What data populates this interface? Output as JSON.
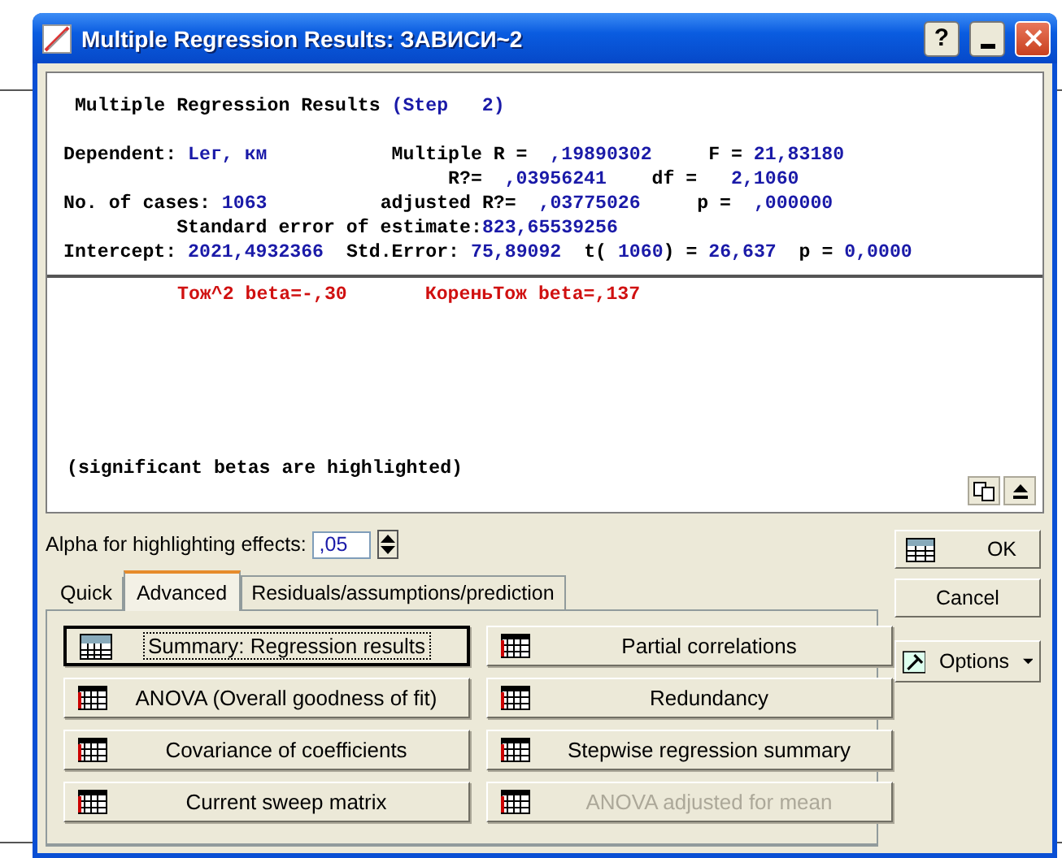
{
  "window": {
    "title": "Multiple Regression Results: ЗАВИСИ~2",
    "help_label": "?"
  },
  "report": {
    "lines": [
      [
        {
          "text": " Multiple Regression Results ",
          "kind": "label"
        },
        {
          "text": "(Step   2)",
          "kind": "value"
        }
      ],
      [
        {
          "text": "Dependent: ",
          "kind": "label"
        },
        {
          "text": "Lег, км",
          "kind": "value"
        },
        {
          "text": "           Multiple R =  ",
          "kind": "label"
        },
        {
          "text": ",19890302",
          "kind": "value"
        },
        {
          "text": "     F = ",
          "kind": "label"
        },
        {
          "text": "21,83180",
          "kind": "value"
        }
      ],
      [
        {
          "text": "                                  R?=  ",
          "kind": "label"
        },
        {
          "text": ",03956241",
          "kind": "value"
        },
        {
          "text": "    df =   ",
          "kind": "label"
        },
        {
          "text": "2,1060",
          "kind": "value"
        }
      ],
      [
        {
          "text": "No. of cases: ",
          "kind": "label"
        },
        {
          "text": "1063",
          "kind": "value"
        },
        {
          "text": "          adjusted R?=  ",
          "kind": "label"
        },
        {
          "text": ",03775026",
          "kind": "value"
        },
        {
          "text": "     p =  ",
          "kind": "label"
        },
        {
          "text": ",000000",
          "kind": "value"
        }
      ],
      [
        {
          "text": "          Standard error of estimate:",
          "kind": "label"
        },
        {
          "text": "823,65539256",
          "kind": "value"
        }
      ],
      [
        {
          "text": "Intercept: ",
          "kind": "label"
        },
        {
          "text": "2021,4932366",
          "kind": "value"
        },
        {
          "text": "  Std.Error: ",
          "kind": "label"
        },
        {
          "text": "75,89092",
          "kind": "value"
        },
        {
          "text": "  t( ",
          "kind": "label"
        },
        {
          "text": "1060",
          "kind": "value"
        },
        {
          "text": ") = ",
          "kind": "label"
        },
        {
          "text": "26,637",
          "kind": "value"
        },
        {
          "text": "  p = ",
          "kind": "label"
        },
        {
          "text": "0,0000",
          "kind": "value"
        }
      ]
    ],
    "betas": [
      {
        "text": "Тож^2 beta=-,30",
        "significant": true
      },
      {
        "text": "КореньТож beta=,137",
        "significant": true
      }
    ],
    "note": "(significant betas are highlighted)"
  },
  "alpha": {
    "label": "Alpha for highlighting effects:",
    "value": ",05"
  },
  "tabs": [
    {
      "label": "Quick",
      "selected": false
    },
    {
      "label": "Advanced",
      "selected": true
    },
    {
      "label": "Residuals/assumptions/prediction",
      "selected": false
    }
  ],
  "actions": [
    {
      "label": "Summary:  Regression results",
      "kind": "summary",
      "focused": true,
      "disabled": false
    },
    {
      "label": "Partial correlations",
      "kind": "table",
      "focused": false,
      "disabled": false
    },
    {
      "label": "ANOVA (Overall goodness of fit)",
      "kind": "table",
      "focused": false,
      "disabled": false
    },
    {
      "label": "Redundancy",
      "kind": "table",
      "focused": false,
      "disabled": false
    },
    {
      "label": "Covariance of coefficients",
      "kind": "table",
      "focused": false,
      "disabled": false
    },
    {
      "label": "Stepwise regression summary",
      "kind": "table",
      "focused": false,
      "disabled": false
    },
    {
      "label": "Current sweep matrix",
      "kind": "table",
      "focused": false,
      "disabled": false
    },
    {
      "label": "ANOVA adjusted for mean",
      "kind": "table",
      "focused": false,
      "disabled": true
    }
  ],
  "side_buttons": [
    {
      "label": "OK",
      "kind": "ok"
    },
    {
      "label": "Cancel",
      "kind": "plain"
    },
    {
      "label": "Options",
      "kind": "menu"
    }
  ]
}
